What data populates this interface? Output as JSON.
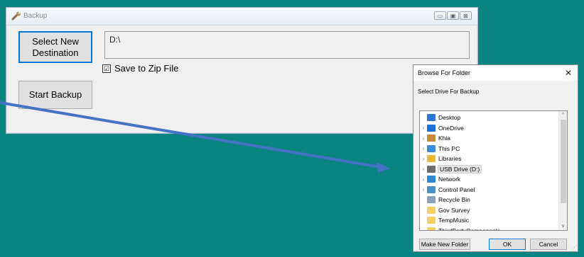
{
  "backup_window": {
    "title": "Backup",
    "controls": {
      "minimize": "▭",
      "maximize": "▣",
      "close": "⊠"
    },
    "select_button": "Select New Destination",
    "destination_value": "D:\\",
    "zip_checked_glyph": "☑",
    "zip_label": "Save to Zip File",
    "start_button": "Start Backup"
  },
  "dialog": {
    "title": "Browse For Folder",
    "close_glyph": "✕",
    "description": "Select Drive For Backup",
    "tree": [
      {
        "label": "Desktop",
        "chevron": "",
        "icon": "desktop-icon",
        "color": "#2b78d4"
      },
      {
        "label": "OneDrive",
        "chevron": "›",
        "icon": "onedrive-icon",
        "color": "#1e6fd9"
      },
      {
        "label": "Khia",
        "chevron": "›",
        "icon": "user-icon",
        "color": "#c58b3a"
      },
      {
        "label": "This PC",
        "chevron": "›",
        "icon": "pc-icon",
        "color": "#3a8fd9"
      },
      {
        "label": "Libraries",
        "chevron": "›",
        "icon": "libraries-icon",
        "color": "#e8b93c"
      },
      {
        "label": "USB Drive (D:)",
        "chevron": "›",
        "icon": "usb-drive-icon",
        "color": "#6e6e6e"
      },
      {
        "label": "Network",
        "chevron": "›",
        "icon": "network-icon",
        "color": "#2f86d3"
      },
      {
        "label": "Control Panel",
        "chevron": "›",
        "icon": "control-panel-icon",
        "color": "#4a90c8"
      },
      {
        "label": "Recycle Bin",
        "chevron": "",
        "icon": "recycle-bin-icon",
        "color": "#8aa0b8"
      },
      {
        "label": "Gov Survey",
        "chevron": "",
        "icon": "folder-icon",
        "color": "#f3cf65"
      },
      {
        "label": "TempMusic",
        "chevron": "",
        "icon": "folder-icon",
        "color": "#f3cf65"
      },
      {
        "label": "ThirdPartyComponents",
        "chevron": "",
        "icon": "folder-icon",
        "color": "#f3cf65"
      }
    ],
    "selected_index": 5,
    "scroll_up": "^",
    "scroll_down": "v",
    "new_folder_button": "Make New Folder",
    "ok_button": "OK",
    "cancel_button": "Cancel",
    "grip": "⋰"
  },
  "colors": {
    "desktop": "#0a8481",
    "arrow": "#4472c4",
    "accent": "#0078d7"
  }
}
